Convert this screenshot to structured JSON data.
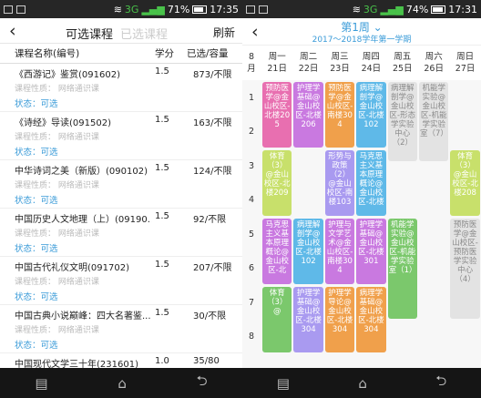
{
  "left": {
    "status": {
      "net": "3G",
      "battery": "71%",
      "time": "17:35"
    },
    "nav": {
      "tab_active": "可选课程",
      "tab_inactive": "已选课程",
      "refresh": "刷新"
    },
    "columns": {
      "name": "课程名称(编号)",
      "credit": "学分",
      "cap": "已选/容量"
    },
    "courses": [
      {
        "name": "《西游记》鉴赏(091602)",
        "credit": "1.5",
        "cap": "873/不限",
        "nature": "课程性质：   网络通识课",
        "state": "状态：可选"
      },
      {
        "name": "《诗经》导读(091502)",
        "credit": "1.5",
        "cap": "163/不限",
        "nature": "课程性质：   网络通识课",
        "state": "状态：可选"
      },
      {
        "name": "中华诗词之美（新版）(090102)",
        "credit": "1.5",
        "cap": "124/不限",
        "nature": "课程性质：   网络通识课",
        "state": "状态：可选"
      },
      {
        "name": "中国历史人文地理（上）(09190...",
        "credit": "1.5",
        "cap": "92/不限",
        "nature": "课程性质：   网络通识课",
        "state": "状态：可选"
      },
      {
        "name": "中国古代礼仪文明(091702)",
        "credit": "1.5",
        "cap": "207/不限",
        "nature": "课程性质：   网络通识课",
        "state": "状态：可选"
      },
      {
        "name": "中国古典小说巅峰：四大名著鉴...",
        "credit": "1.5",
        "cap": "30/不限",
        "nature": "课程性质：   网络通识课",
        "state": "状态：可选"
      },
      {
        "name": "中国现代文学三十年(231601)",
        "credit": "1.0",
        "cap": "35/80",
        "nature": "",
        "state": ""
      }
    ]
  },
  "right": {
    "status": {
      "net": "3G",
      "battery": "74%",
      "time": "17:31"
    },
    "week_title": "第1周 ⌄",
    "semester": "2017～2018学年第一学期",
    "month": {
      "num": "8",
      "unit": "月"
    },
    "days": [
      {
        "name": "周一",
        "date": "21日"
      },
      {
        "name": "周二",
        "date": "22日"
      },
      {
        "name": "周三",
        "date": "23日"
      },
      {
        "name": "周四",
        "date": "24日"
      },
      {
        "name": "周五",
        "date": "25日"
      },
      {
        "name": "周六",
        "date": "26日"
      },
      {
        "name": "周日",
        "date": "27日"
      }
    ],
    "periods": [
      "1",
      "2",
      "3",
      "4",
      "5",
      "6",
      "7",
      "8"
    ],
    "blocks": [
      {
        "text": "预防医学@金山校区-北楼205",
        "color": "#e86fb0",
        "day": 0,
        "start": 0,
        "span": 2
      },
      {
        "text": "护理学基础@金山校区-北楼206",
        "color": "#c979e0",
        "day": 1,
        "start": 0,
        "span": 2
      },
      {
        "text": "预防医学@金山校区-南楼304",
        "color": "#f0a04b",
        "day": 2,
        "start": 0,
        "span": 2
      },
      {
        "text": "病理解剖学@金山校区-北楼102",
        "color": "#5fb9e8",
        "day": 3,
        "start": 0,
        "span": 2
      },
      {
        "text": "病理解剖学@金山校区-形态学实验中心（2）",
        "color": "#e3e3e3",
        "day": 4,
        "start": 0,
        "span": 2.4,
        "dark": true
      },
      {
        "text": "机能学实验@金山校区-机能学实验室（7）",
        "color": "#e3e3e3",
        "day": 5,
        "start": 0,
        "span": 2.4,
        "dark": true
      },
      {
        "text": "体育（3）@金山校区-北楼209",
        "color": "#c8e06b",
        "day": 0,
        "start": 2,
        "span": 2
      },
      {
        "text": "形势与政策（2）@金山校区-南楼103",
        "color": "#a99af0",
        "day": 2,
        "start": 2,
        "span": 2
      },
      {
        "text": "马克思主义基本原理概论@金山校区-北楼",
        "color": "#5fb9e8",
        "day": 3,
        "start": 2,
        "span": 2
      },
      {
        "text": "体育（3）@金山校区-北楼208",
        "color": "#c8e06b",
        "day": 6,
        "start": 2,
        "span": 2
      },
      {
        "text": "马克思主义基本原理概论@金山校区-北",
        "color": "#c979e0",
        "day": 0,
        "start": 4,
        "span": 2
      },
      {
        "text": "病理解剖学@金山校区-北楼102",
        "color": "#5fb9e8",
        "day": 1,
        "start": 4,
        "span": 2
      },
      {
        "text": "护理与文学艺术@金山校区-南楼304",
        "color": "#c979e0",
        "day": 2,
        "start": 4,
        "span": 2
      },
      {
        "text": "护理学基础@金山校区-北楼301",
        "color": "#c979e0",
        "day": 3,
        "start": 4,
        "span": 2
      },
      {
        "text": "机能学实验@金山校区-机能学实验室（1）",
        "color": "#7bc86c",
        "day": 4,
        "start": 4,
        "span": 3
      },
      {
        "text": "预防医学@金山校区-预防医学实验中心（4）",
        "color": "#e3e3e3",
        "day": 6,
        "start": 4,
        "span": 3,
        "dark": true
      },
      {
        "text": "体育（3）@",
        "color": "#7bc86c",
        "day": 0,
        "start": 6,
        "span": 2
      },
      {
        "text": "护理学基础@金山校区-北楼304",
        "color": "#a99af0",
        "day": 1,
        "start": 6,
        "span": 2
      },
      {
        "text": "护理学导论@金山校区-北楼304",
        "color": "#f0a04b",
        "day": 2,
        "start": 6,
        "span": 2
      },
      {
        "text": "病理学基础@金山校区-北楼304",
        "color": "#f0a04b",
        "day": 3,
        "start": 6,
        "span": 2
      }
    ]
  }
}
